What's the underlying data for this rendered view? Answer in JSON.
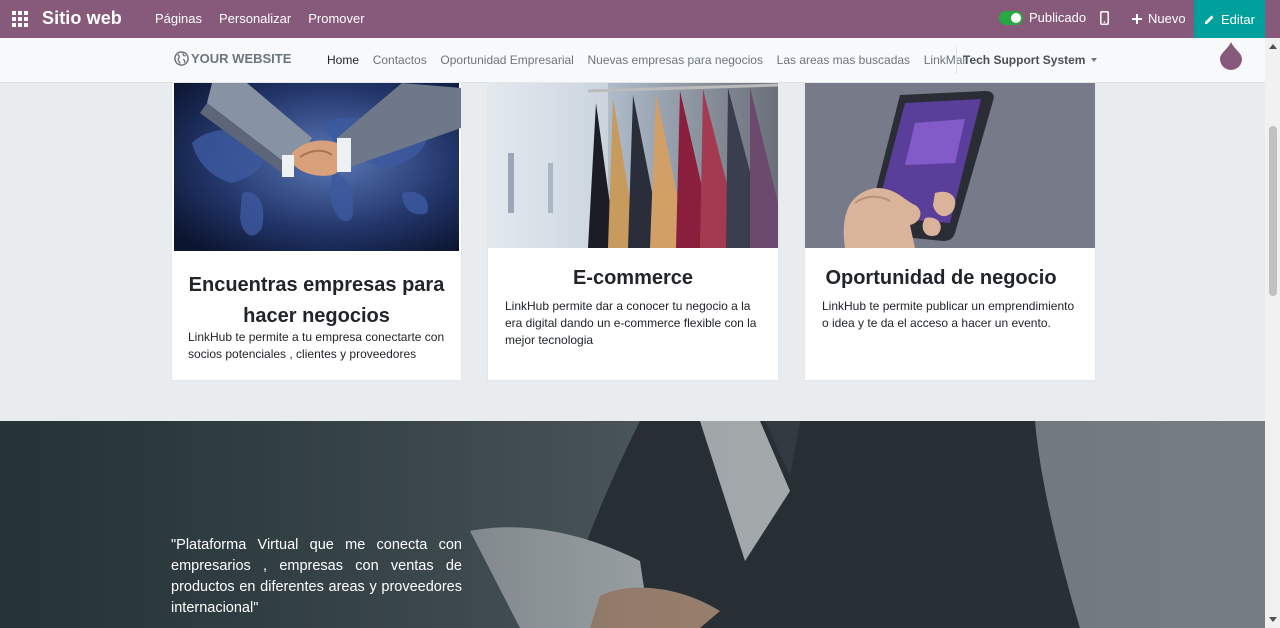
{
  "adminbar": {
    "app_title": "Sitio web",
    "menu": [
      "Páginas",
      "Personalizar",
      "Promover"
    ],
    "published_label": "Publicado",
    "new_label": "Nuevo",
    "edit_label": "Editar",
    "color": "#875a7b",
    "edit_color": "#00a09d"
  },
  "sitenav": {
    "logo_text": "YOUR WEBSITE",
    "items": [
      {
        "label": "Home",
        "active": true
      },
      {
        "label": "Contactos"
      },
      {
        "label": "Oportunidad Empresarial"
      },
      {
        "label": "Nuevas empresas para negocios"
      },
      {
        "label": "Las areas mas buscadas"
      },
      {
        "label": "LinkMall"
      }
    ],
    "dropdown_label": "Tech Support System"
  },
  "cards": [
    {
      "image": "handshake-over-world-map",
      "title_line1": "Encuentras empresas para",
      "title_line2": "hacer negocios",
      "text": "LinkHub te permite a tu empresa conectarte con socios potenciales , clientes y proveedores"
    },
    {
      "image": "clothing-rack-store",
      "title": "E-commerce",
      "text": "LinkHub permite dar a conocer tu negocio a la era digital dando un e-commerce flexible con la mejor tecnologia"
    },
    {
      "image": "hand-holding-smartphone",
      "title": "Oportunidad de negocio",
      "text": "LinkHub te permite publicar un emprendimiento o idea y te da el acceso a hacer un evento."
    }
  ],
  "hero": {
    "image": "businessman-with-tablet",
    "quote": "\"Plataforma Virtual que me conecta con empresarios , empresas con ventas de productos en diferentes areas y proveedores internacional\""
  }
}
